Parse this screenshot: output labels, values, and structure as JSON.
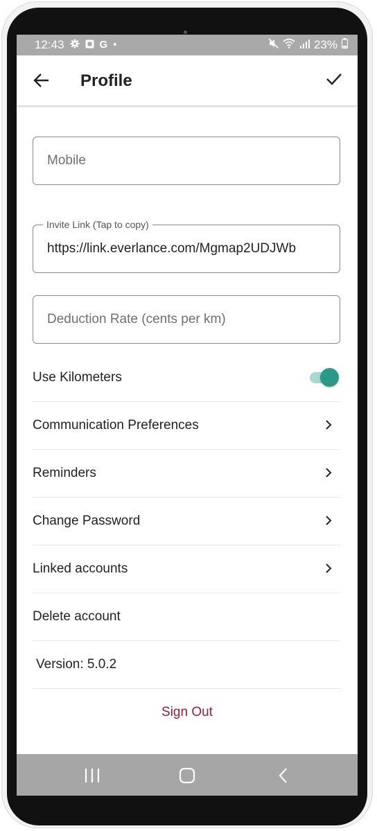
{
  "status_bar": {
    "time": "12:43",
    "left_icons": [
      "gear-icon",
      "photo-icon",
      "google-icon",
      "dot-icon"
    ],
    "google_glyph": "G",
    "dot_glyph": "•",
    "battery": "23%",
    "right_icons": [
      "mute-icon",
      "wifi-icon",
      "signal-icon",
      "battery-icon"
    ]
  },
  "appbar": {
    "title": "Profile",
    "back_icon": "arrow-left-icon",
    "save_icon": "check-icon"
  },
  "fields": {
    "mobile": {
      "placeholder": "Mobile",
      "value": ""
    },
    "invite_link": {
      "label": "Invite Link (Tap to copy)",
      "value": "https://link.everlance.com/Mgmap2UDJWb"
    },
    "deduction_rate": {
      "placeholder": "Deduction Rate (cents per km)",
      "value": ""
    }
  },
  "settings": {
    "use_kilometers": {
      "label": "Use Kilometers",
      "enabled": true
    },
    "communication": {
      "label": "Communication Preferences"
    },
    "reminders": {
      "label": "Reminders"
    },
    "change_password": {
      "label": "Change Password"
    },
    "linked_accounts": {
      "label": "Linked accounts"
    },
    "delete_account": {
      "label": "Delete account"
    }
  },
  "version": "Version: 5.0.2",
  "sign_out": "Sign Out",
  "colors": {
    "accent": "#2a9a86",
    "accent_track": "#a8d8d0",
    "sign_out": "#9c1b3c",
    "status_bar": "#a9a9a9",
    "nav_bar": "#a6a6a6"
  },
  "nav_bar": {
    "icons": [
      "recent-apps-icon",
      "home-icon",
      "back-nav-icon"
    ]
  }
}
